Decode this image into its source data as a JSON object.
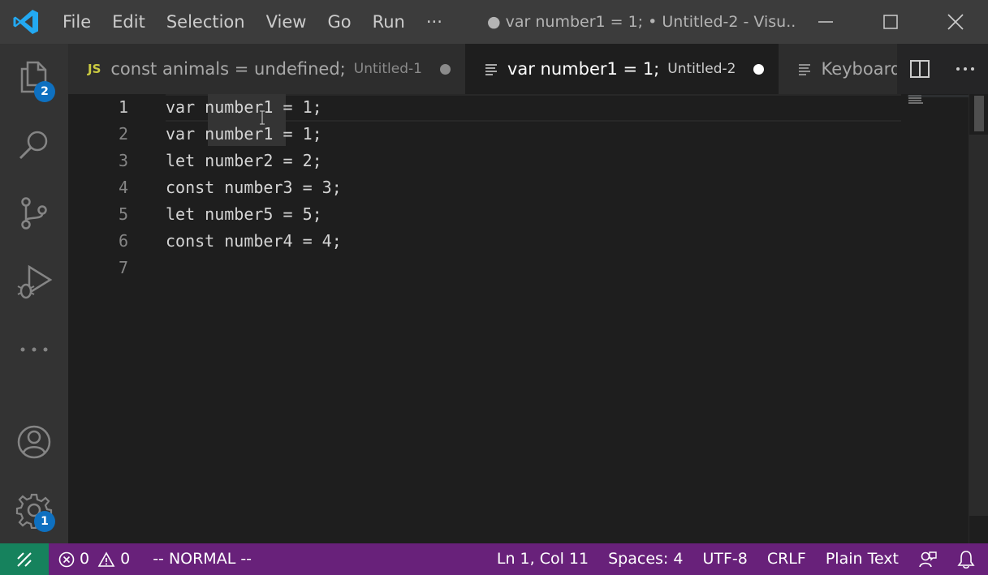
{
  "titlebar": {
    "menu": [
      "File",
      "Edit",
      "Selection",
      "View",
      "Go",
      "Run",
      "···"
    ],
    "title": "● var number1 = 1; • Untitled-2 - Visu..."
  },
  "activity": {
    "explorer_badge": "2",
    "settings_badge": "1"
  },
  "tabs": [
    {
      "icon": "JS",
      "label": "const animals = undefined;",
      "desc": "Untitled-1",
      "active": false
    },
    {
      "label": "var number1 = 1;",
      "desc": "Untitled-2",
      "active": true
    },
    {
      "label": "Keyboard"
    }
  ],
  "editor": {
    "lines": [
      {
        "num": "1",
        "text": "var number1 = 1;"
      },
      {
        "num": "2",
        "text": "var number1 = 1;"
      },
      {
        "num": "3",
        "text": "let number2 = 2;"
      },
      {
        "num": "4",
        "text": "const number3 = 3;"
      },
      {
        "num": "5",
        "text": "let number5 = 5;"
      },
      {
        "num": "6",
        "text": "const number4 = 4;"
      },
      {
        "num": "7",
        "text": ""
      }
    ]
  },
  "statusbar": {
    "errors": "0",
    "warnings": "0",
    "mode": "-- NORMAL --",
    "position": "Ln 1, Col 11",
    "spaces": "Spaces: 4",
    "encoding": "UTF-8",
    "eol": "CRLF",
    "language": "Plain Text"
  },
  "colors": {
    "statusbar": "#68217a",
    "remote": "#16825d",
    "badge": "#0e70c0",
    "vscode_blue": "#23a9f2"
  }
}
